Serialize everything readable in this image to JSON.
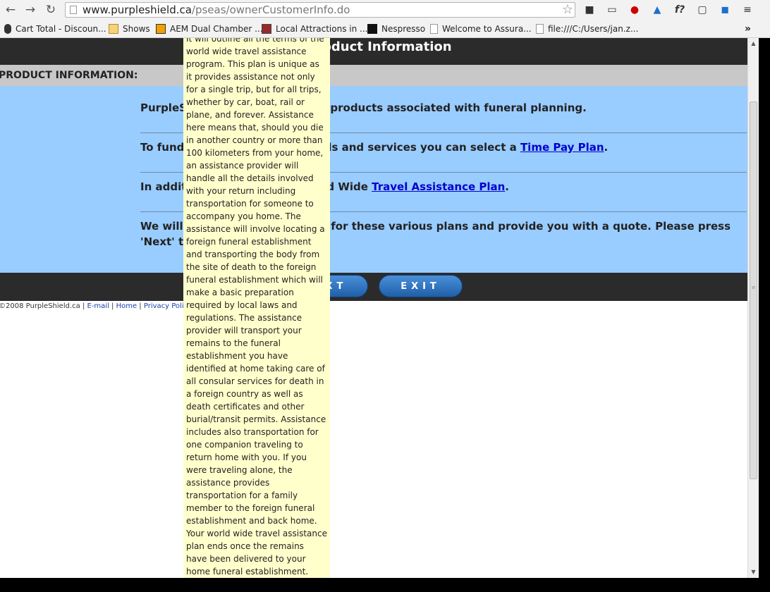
{
  "browser": {
    "url_host": "www.purpleshield.ca",
    "url_path": "/pseas/ownerCustomerInfo.do",
    "bookmarks": [
      {
        "label": "Cart Total - Discoun...",
        "icon": "generic-site-icon"
      },
      {
        "label": "Shows",
        "icon": "folder-icon"
      },
      {
        "label": "AEM Dual Chamber ...",
        "icon": "aem-site-icon"
      },
      {
        "label": "Local Attractions in ...",
        "icon": "local-attractions-icon"
      },
      {
        "label": "Nespresso",
        "icon": "nespresso-icon"
      },
      {
        "label": "Welcome to Assura...",
        "icon": "page-icon"
      },
      {
        "label": "file:///C:/Users/jan.z...",
        "icon": "page-icon"
      }
    ],
    "more_bookmarks": "»"
  },
  "page": {
    "title": "Product Information",
    "section_label": "PRODUCT INFORMATION:",
    "rows": [
      {
        "pre": "PurpleShield offers a variety of products associated with funeral planning.",
        "link": "",
        "post": ""
      },
      {
        "pre": "To fund the cost of funeral goods and services you can select a ",
        "link": "Time Pay Plan",
        "post": "."
      },
      {
        "pre": "In addition, you can add a World Wide ",
        "link": "Travel Assistance Plan",
        "post": "."
      },
      {
        "pre": "We will calculate the premiums for these various plans and provide you with a quote. Please press 'Next' to continue.",
        "link": "",
        "post": ""
      }
    ],
    "buttons": {
      "next": "NEXT",
      "exit": "EXIT"
    },
    "footer": {
      "copyright": "©2008 PurpleShield.ca",
      "separator": " | ",
      "links": [
        "E-mail",
        "Home",
        "Privacy Policy"
      ]
    },
    "tooltip": "It will outline all the terms of the world wide travel assistance program. This plan is unique as it provides assistance not only for a single trip, but for all trips, whether by car, boat, rail or plane, and forever. Assistance here means that, should you die in another country or more than 100 kilometers from your home, an assistance provider will handle all the details involved with your return including transportation for someone to accompany you home. The assistance will involve locating a foreign funeral establishment and transporting the body from the site of death to the foreign funeral establishment which will make a basic preparation required by local laws and regulations. The assistance provider will transport your remains to the funeral establishment you have identified at home taking care of all consular services for death in a foreign country as well as death certificates and other burial/transit permits. Assistance includes also transportation for one companion traveling to return home with you. If you were traveling alone, the assistance provides transportation for a family member to the foreign funeral establishment and back home. Your world wide travel assistance plan ends once the remains have been delivered to your home funeral establishment. Your home funeral establishment can then provide the funeral services you have chosen."
  },
  "colors": {
    "header": "#2b2b2b",
    "section_bar": "#c8c8c8",
    "panel": "#99ccff",
    "tooltip": "#ffffcc",
    "button": "#2a6fc0",
    "link": "#0000cc"
  }
}
